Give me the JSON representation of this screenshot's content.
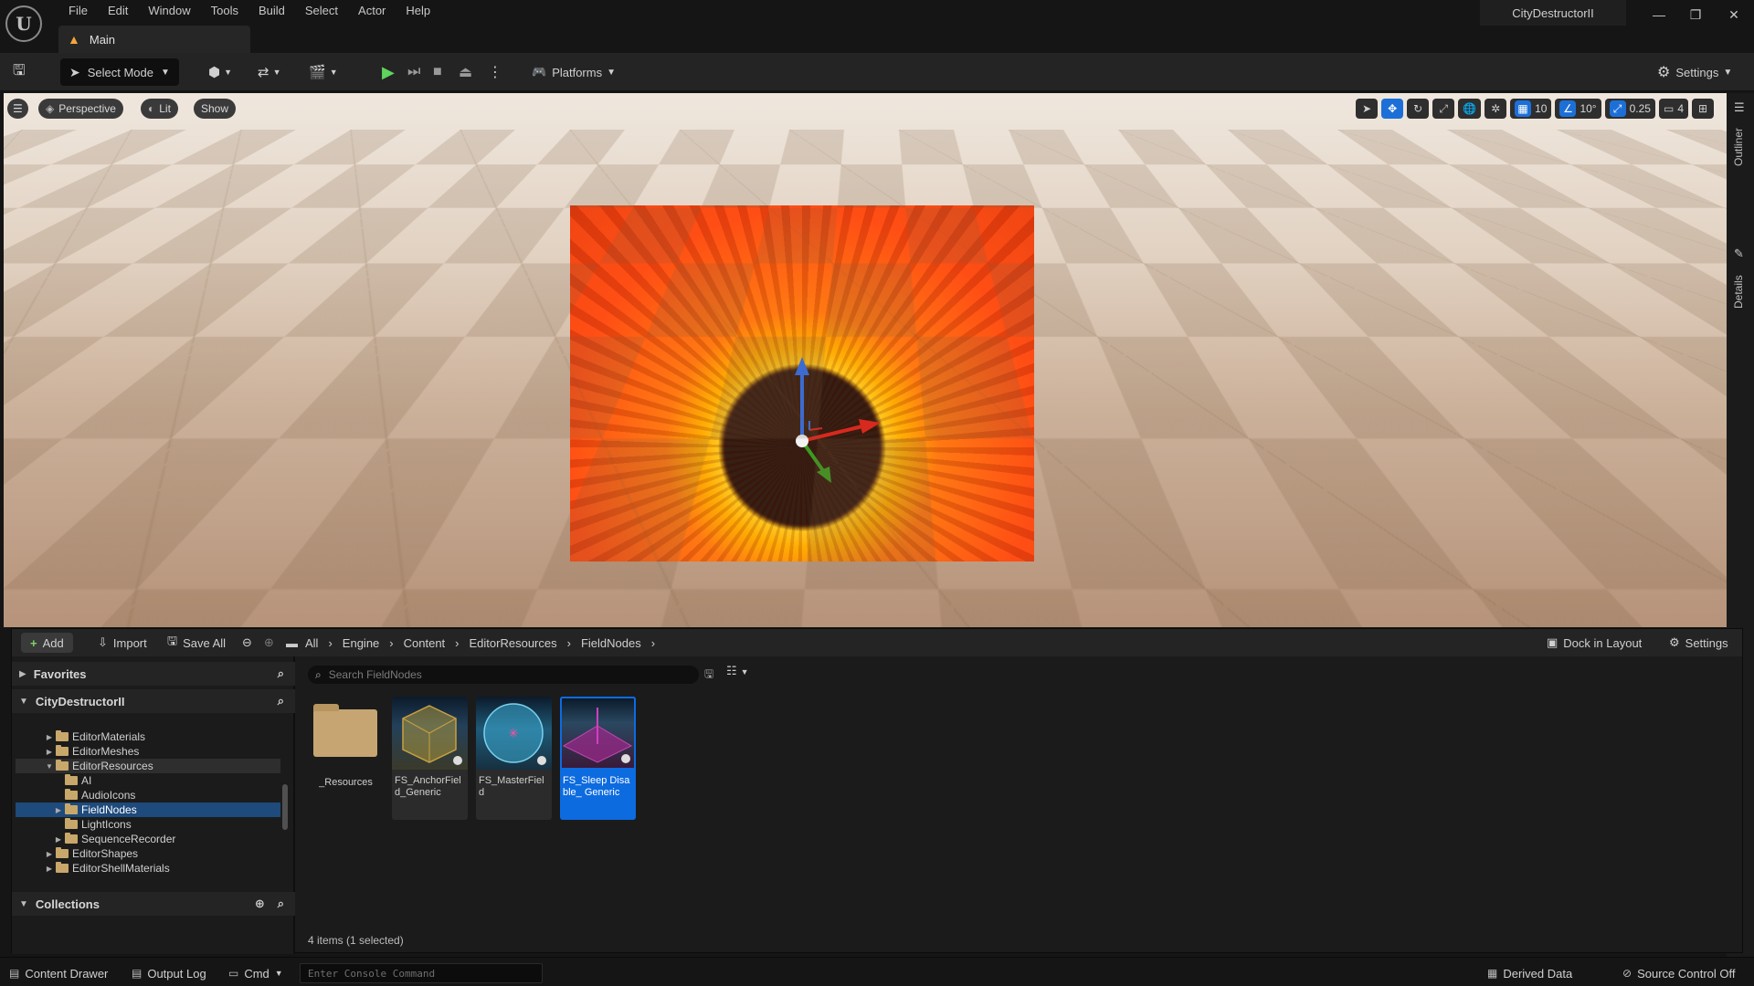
{
  "app": {
    "menu": [
      "File",
      "Edit",
      "Window",
      "Tools",
      "Build",
      "Select",
      "Actor",
      "Help"
    ],
    "tab_title": "Main",
    "project_name": "CityDestructorII"
  },
  "toolbar": {
    "select_mode": "Select Mode",
    "platforms": "Platforms",
    "settings": "Settings"
  },
  "viewport": {
    "perspective": "Perspective",
    "lit": "Lit",
    "show": "Show",
    "grid_snap": "10",
    "rotation_snap": "10°",
    "scale_snap": "0.25",
    "camera_speed": "4",
    "right_rail": [
      "Outliner",
      "Details"
    ]
  },
  "content_browser": {
    "add": "Add",
    "import": "Import",
    "save_all": "Save All",
    "breadcrumb": [
      "All",
      "Engine",
      "Content",
      "EditorResources",
      "FieldNodes"
    ],
    "dock_in_layout": "Dock in Layout",
    "settings": "Settings",
    "favorites": "Favorites",
    "project": "CityDestructorII",
    "collections": "Collections",
    "tree": [
      {
        "label": "EditorMaterials",
        "level": 0
      },
      {
        "label": "EditorMeshes",
        "level": 0
      },
      {
        "label": "EditorResources",
        "level": 0
      },
      {
        "label": "AI",
        "level": 1
      },
      {
        "label": "AudioIcons",
        "level": 1
      },
      {
        "label": "FieldNodes",
        "level": 1
      },
      {
        "label": "LightIcons",
        "level": 1
      },
      {
        "label": "SequenceRecorder",
        "level": 1
      },
      {
        "label": "EditorShapes",
        "level": 0
      },
      {
        "label": "EditorShellMaterials",
        "level": 0
      }
    ],
    "search_placeholder": "Search FieldNodes",
    "assets": [
      {
        "name": "_Resources"
      },
      {
        "name": "FS_AnchorField_Generic"
      },
      {
        "name": "FS_MasterField"
      },
      {
        "name": "FS_Sleep Disable_ Generic"
      }
    ],
    "item_count": "4 items (1 selected)"
  },
  "statusbar": {
    "content_drawer": "Content Drawer",
    "output_log": "Output Log",
    "cmd": "Cmd",
    "console_placeholder": "Enter Console Command",
    "derived_data": "Derived Data",
    "source_control": "Source Control Off"
  }
}
